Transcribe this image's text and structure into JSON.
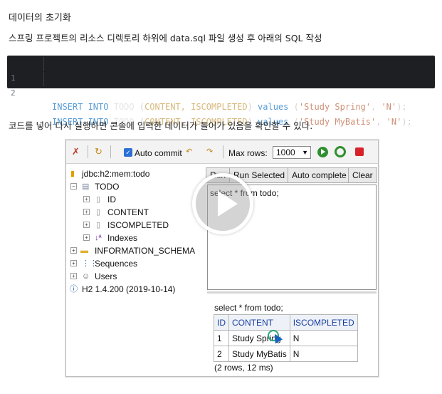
{
  "heading": "데이터의 초기화",
  "para1": "스프링 프로젝트의 리소스 디렉토리 하위에 data.sql 파일 생성 후 아래의 SQL 작성",
  "code": {
    "lines": [
      {
        "num": "1",
        "kw1": "INSERT INTO",
        "table": "TODO",
        "open": " (",
        "cols": "CONTENT, ISCOMPLETED",
        "close": ") ",
        "kw2": "values",
        "vopen": " (",
        "s1": "'Study Spring'",
        "comma": ", ",
        "s2": "'N'",
        "end": ");"
      },
      {
        "num": "2",
        "kw1": "INSERT INTO",
        "table": "TODO",
        "open": " (",
        "cols": "CONTENT, ISCOMPLETED",
        "close": ") ",
        "kw2": "values",
        "vopen": " (",
        "s1": "'Study MyBatis'",
        "comma": ", ",
        "s2": "'N'",
        "end": ");"
      }
    ]
  },
  "para2": "코드를 넣어 다시 실행하면 콘솔에 입력한 데이터가 들어가 있음을 확인할 수 있다.",
  "h2": {
    "toolbar": {
      "auto_commit": "Auto commit",
      "max_rows_label": "Max rows:",
      "max_rows_value": "1000"
    },
    "tree": {
      "connection": "jdbc:h2:mem:todo",
      "table": "TODO",
      "columns": [
        "ID",
        "CONTENT",
        "ISCOMPLETED"
      ],
      "indexes": "Indexes",
      "schema": "INFORMATION_SCHEMA",
      "sequences": "Sequences",
      "users": "Users",
      "version": "H2 1.4.200 (2019-10-14)"
    },
    "buttons": {
      "run": "Run",
      "run_selected": "Run Selected",
      "auto_complete": "Auto complete",
      "clear": "Clear"
    },
    "sql": "select * from todo;",
    "result": {
      "query": "select * from todo;",
      "headers": [
        "ID",
        "CONTENT",
        "ISCOMPLETED"
      ],
      "rows": [
        [
          "1",
          "Study Spring",
          "N"
        ],
        [
          "2",
          "Study MyBatis",
          "N"
        ]
      ],
      "footer": "(2 rows, 12 ms)"
    }
  }
}
